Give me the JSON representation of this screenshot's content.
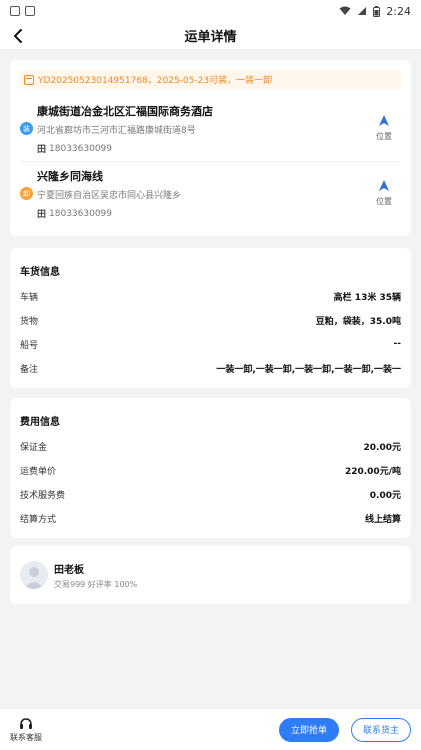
{
  "status_bar": {
    "time": "2:24"
  },
  "nav": {
    "title": "运单详情"
  },
  "order": {
    "header": "YD20250523014951768，2025-05-23可装，一装一卸",
    "routes": [
      {
        "badge": "装",
        "title": "康城街道冶金北区汇福国际商务酒店",
        "address": "河北省廊坊市三河市汇福路康城街道8号",
        "phone_icon": "田",
        "phone": "18033630099",
        "loc_label": "位置"
      },
      {
        "badge": "卸",
        "title": "兴隆乡同海线",
        "address": "宁夏回族自治区吴忠市同心县兴隆乡",
        "phone_icon": "田",
        "phone": "18033630099",
        "loc_label": "位置"
      }
    ]
  },
  "cargo": {
    "title": "车货信息",
    "rows": [
      {
        "key": "车辆",
        "value": "高栏 13米 35辆"
      },
      {
        "key": "货物",
        "value": "豆粕，袋装，35.0吨"
      },
      {
        "key": "船号",
        "value": "--"
      },
      {
        "key": "备注",
        "value": "一装一卸,一装一卸,一装一卸,一装一卸,一装一"
      }
    ]
  },
  "fee": {
    "title": "费用信息",
    "rows": [
      {
        "key": "保证金",
        "value": "20.00元"
      },
      {
        "key": "运费单价",
        "value": "220.00元/吨"
      },
      {
        "key": "技术服务费",
        "value": "0.00元"
      },
      {
        "key": "结算方式",
        "value": "线上结算"
      }
    ]
  },
  "owner": {
    "name": "田老板",
    "stats": "交易999 好评率 100%"
  },
  "bottom": {
    "service_label": "联系客服",
    "grab_label": "立即抢单",
    "contact_label": "联系货主"
  },
  "colors": {
    "accent": "#2f7df5",
    "order_header": "#f08a24",
    "load_badge": "#3a9cf0",
    "unload_badge": "#f5a23a"
  }
}
